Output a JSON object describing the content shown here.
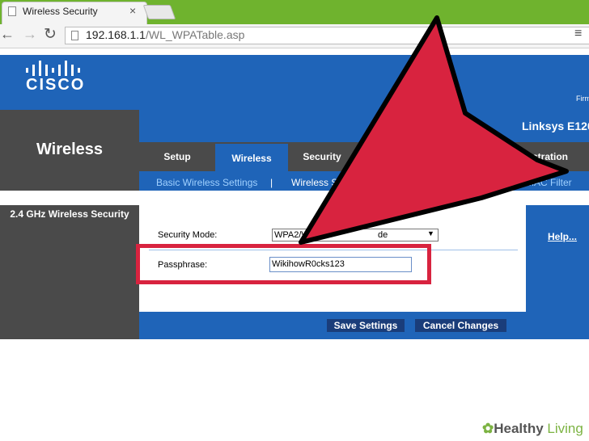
{
  "browser": {
    "tab_title": "Wireless Security",
    "close_glyph": "×",
    "url_host": "192.168.1.1",
    "url_path": "/WL_WPATable.asp"
  },
  "router": {
    "brand": "CISCO",
    "firmware_fragment": "Firm",
    "section": "Wireless",
    "model": "Linksys E120",
    "tabs": [
      "Setup",
      "Wireless",
      "Security",
      "stration"
    ],
    "subnav": [
      "Basic Wireless Settings",
      "|",
      "Wireless Se",
      "MAC Filter"
    ],
    "side_title": "2.4 GHz Wireless Security",
    "help": "Help...",
    "security_mode_label": "Security Mode:",
    "security_mode_value": "WPA2/WF",
    "security_mode_fragment": "de",
    "passphrase_label": "Passphrase:",
    "passphrase_value": "WikihowR0cks123",
    "save_label": "Save Settings",
    "cancel_label": "Cancel Changes"
  },
  "colors": {
    "router_blue": "#1f64b8",
    "router_gray": "#4a4a4a",
    "annotation_red": "#d8233f"
  },
  "watermark": {
    "part_a": "Healthy",
    "part_b": "Living"
  }
}
